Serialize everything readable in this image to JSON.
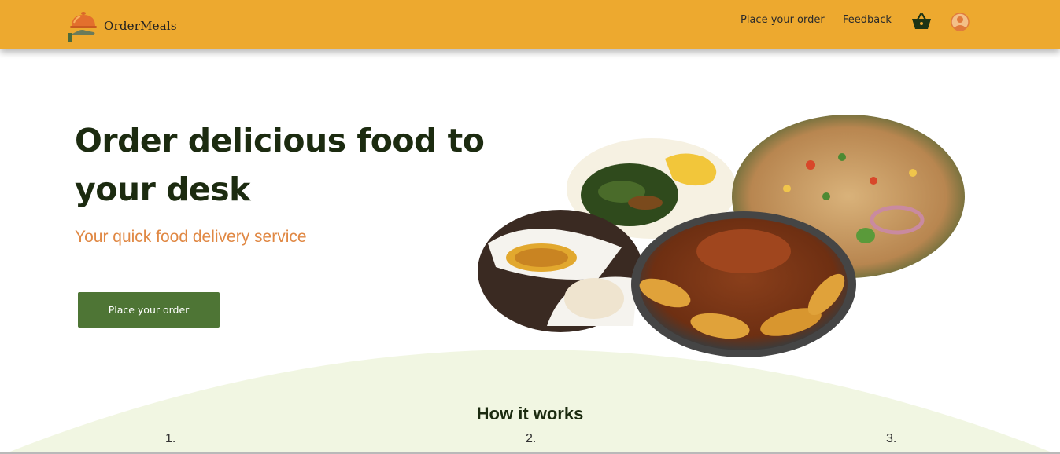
{
  "nav": {
    "brand": "OrderMeals",
    "logo_icon": "serving-cloche-icon",
    "links": [
      {
        "label": "Place your order"
      },
      {
        "label": "Feedback"
      }
    ],
    "cart_icon": "basket-icon",
    "profile_icon": "user-avatar-icon"
  },
  "hero": {
    "title": "Order delicious food to your desk",
    "subtitle": "Your quick food delivery service",
    "cta_label": "Place your order"
  },
  "how_it_works": {
    "title": "How it works",
    "steps": [
      "1.",
      "2.",
      "3."
    ]
  },
  "colors": {
    "navbar": "#eda92f",
    "primary_green": "#4e7535",
    "title_text": "#1c2b10",
    "subtitle_accent": "#e08844",
    "curve_bg": "#f1f6e2"
  }
}
